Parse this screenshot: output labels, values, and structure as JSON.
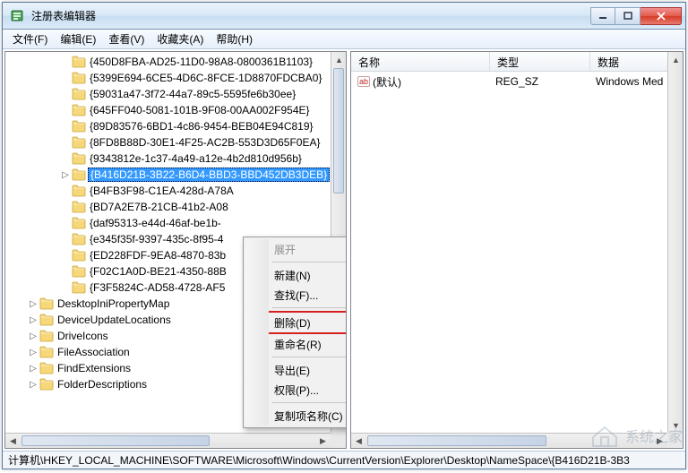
{
  "window": {
    "title": "注册表编辑器"
  },
  "menu": {
    "file": "文件(F)",
    "edit": "编辑(E)",
    "view": "查看(V)",
    "fav": "收藏夹(A)",
    "help": "帮助(H)"
  },
  "tree": {
    "guid_items": [
      "{450D8FBA-AD25-11D0-98A8-0800361B1103}",
      "{5399E694-6CE5-4D6C-8FCE-1D8870FDCBA0}",
      "{59031a47-3f72-44a7-89c5-5595fe6b30ee}",
      "{645FF040-5081-101B-9F08-00AA002F954E}",
      "{89D83576-6BD1-4c86-9454-BEB04E94C819}",
      "{8FD8B88D-30E1-4F25-AC2B-553D3D65F0EA}",
      "{9343812e-1c37-4a49-a12e-4b2d810d956b}",
      "{B416D21B-3B22-B6D4-BBD3-BBD452DB3DEB}",
      "{B4FB3F98-C1EA-428d-A78A",
      "{BD7A2E7B-21CB-41b2-A08",
      "{daf95313-e44d-46af-be1b-",
      "{e345f35f-9397-435c-8f95-4",
      "{ED228FDF-9EA8-4870-83b",
      "{F02C1A0D-BE21-4350-88B",
      "{F3F5824C-AD58-4728-AF5"
    ],
    "selected_index": 7,
    "other": [
      "DesktopIniPropertyMap",
      "DeviceUpdateLocations",
      "DriveIcons",
      "FileAssociation",
      "FindExtensions",
      "FolderDescriptions"
    ]
  },
  "list": {
    "cols": {
      "name": "名称",
      "type": "类型",
      "data": "数据"
    },
    "row": {
      "name": "(默认)",
      "type": "REG_SZ",
      "data": "Windows Med"
    }
  },
  "context": {
    "expand": "展开",
    "new": "新建(N)",
    "find": "查找(F)...",
    "delete": "删除(D)",
    "rename": "重命名(R)",
    "export": "导出(E)",
    "perm": "权限(P)...",
    "copyname": "复制项名称(C)"
  },
  "status": "计算机\\HKEY_LOCAL_MACHINE\\SOFTWARE\\Microsoft\\Windows\\CurrentVersion\\Explorer\\Desktop\\NameSpace\\{B416D21B-3B3",
  "watermark": "系统之家"
}
